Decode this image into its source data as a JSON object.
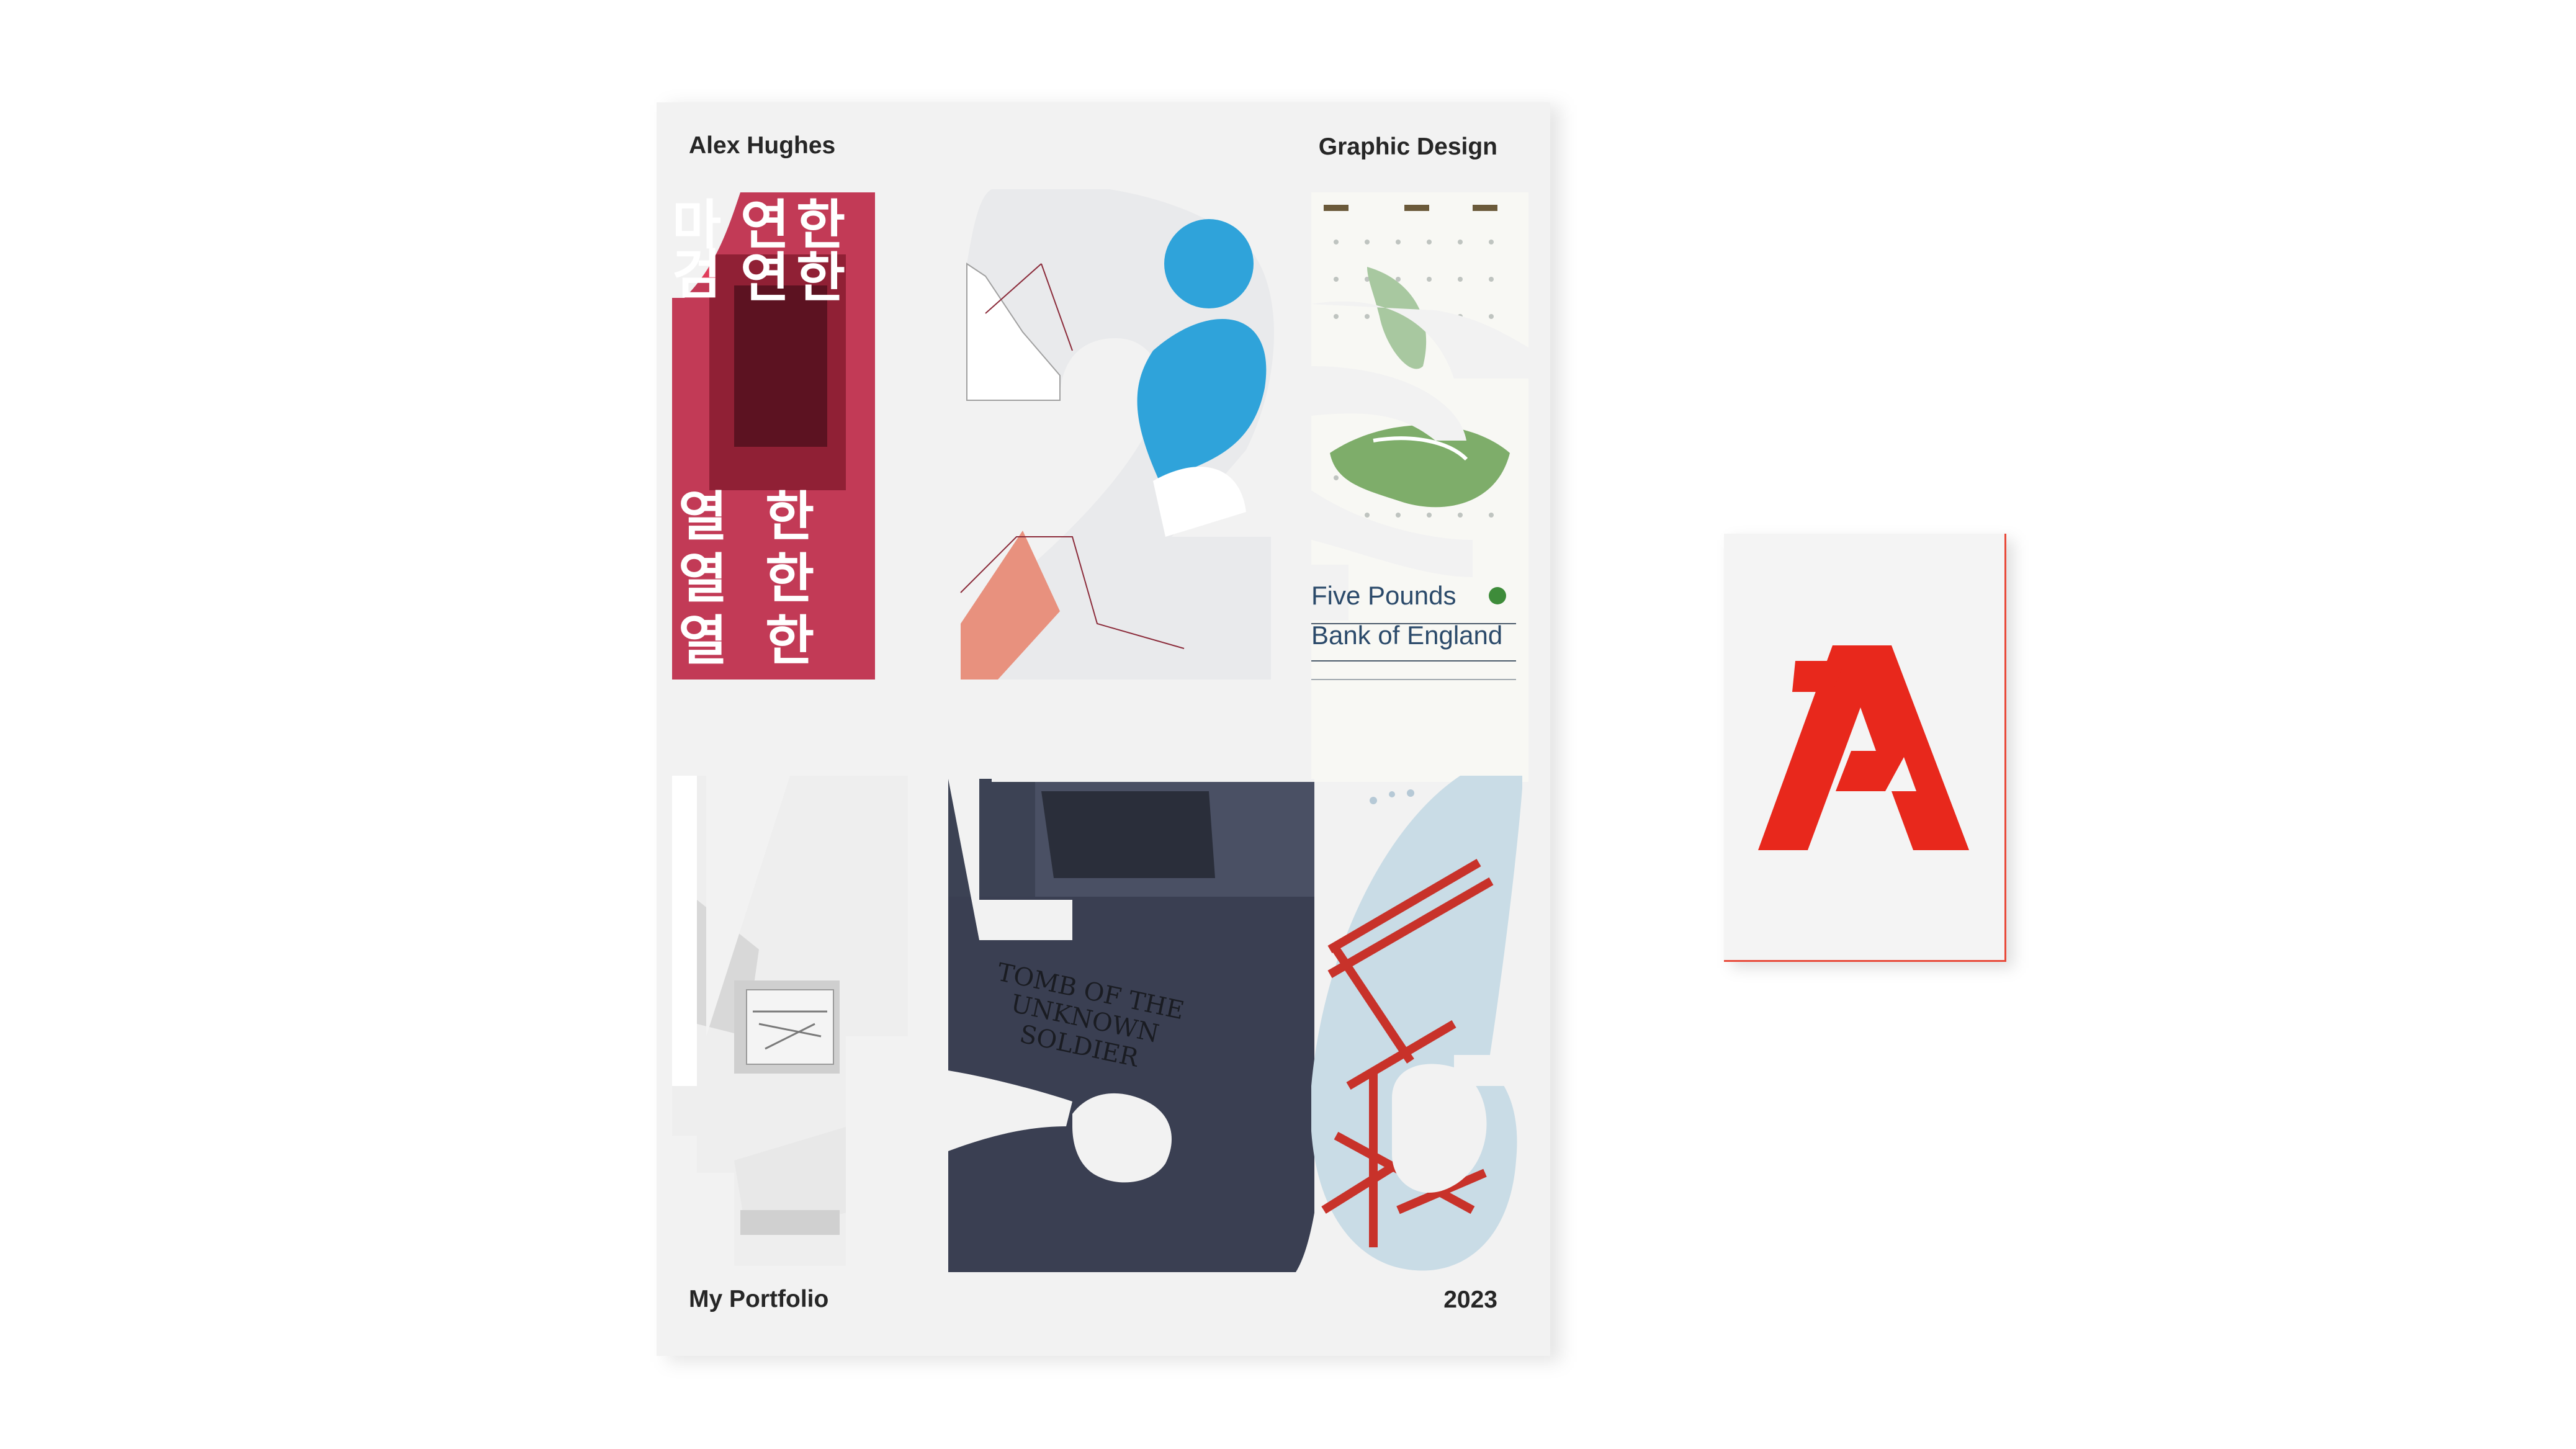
{
  "booklet": {
    "author": "Alex Hughes",
    "discipline": "Graphic Design",
    "title": "My Portfolio",
    "year": "2023",
    "cutout_numbers": [
      "1",
      "2",
      "3",
      "4",
      "5",
      "6"
    ]
  },
  "windows": {
    "w1": {
      "korean_top": [
        "연",
        "한"
      ],
      "korean_rows": [
        [
          "열",
          "한"
        ],
        [
          "열",
          "한"
        ],
        [
          "열",
          "한"
        ]
      ],
      "korean_edge": [
        "마",
        "검"
      ]
    },
    "w3": {
      "note_line1": "Five Pounds",
      "note_line2": "Bank of England"
    },
    "w5": {
      "tomb_text": "TOMB OF THE UNKNOWN SOLDIER"
    }
  },
  "card": {
    "logo_letter": "A",
    "logo_color": "#e8281c"
  },
  "colors": {
    "background": "#ffffff",
    "cover": "#f2f2f2",
    "text": "#262626",
    "accent_red": "#e8281c",
    "accent_blue": "#2fa3da",
    "korean_bg": "#c23a56"
  }
}
